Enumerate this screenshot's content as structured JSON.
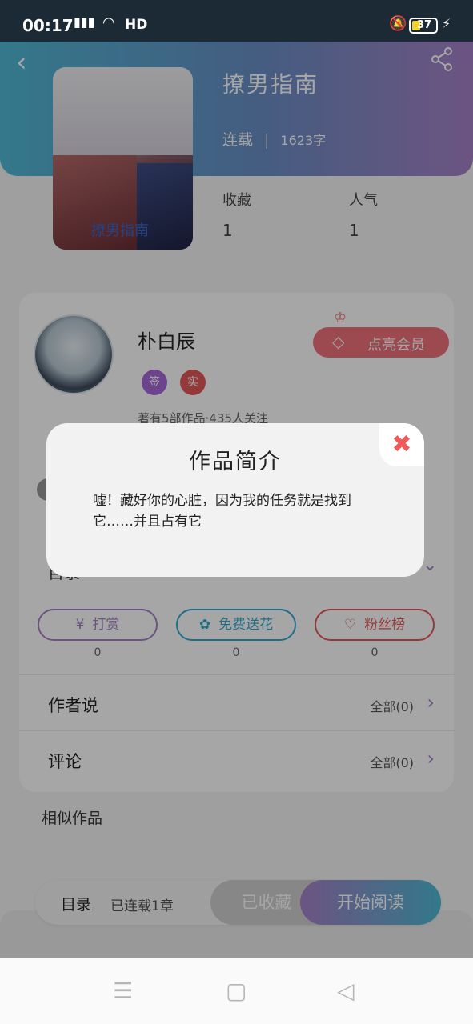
{
  "status_bar": {
    "time": "00:17",
    "network": "4G",
    "hd": "HD",
    "battery": "37"
  },
  "header": {
    "title": "撩男指南",
    "status": "连载",
    "word_count": "1623字"
  },
  "stats": [
    {
      "label": "收藏",
      "value": "1"
    },
    {
      "label": "人气",
      "value": "1"
    }
  ],
  "cover": {
    "text": "撩男指南"
  },
  "author": {
    "name": "朴白辰",
    "badge_sign": "签",
    "badge_real": "实",
    "works_info": "著有5部作品·435人关注",
    "vip_label": "点亮会员"
  },
  "directory": {
    "label": "目录"
  },
  "actions": [
    {
      "label": "打赏",
      "count": "0"
    },
    {
      "label": "免费送花",
      "count": "0"
    },
    {
      "label": "粉丝榜",
      "count": "0"
    }
  ],
  "author_says": {
    "label": "作者说",
    "all": "全部(0)"
  },
  "comments": {
    "label": "评论",
    "all": "全部(0)"
  },
  "similar": "相似作品",
  "bottom": {
    "dir_label": "目录",
    "progress": "已连载1章",
    "collected": "已收藏",
    "read": "开始阅读"
  },
  "modal": {
    "title": "作品简介",
    "body": "嘘！藏好你的心脏，因为我的任务就是找到它……并且占有它",
    "close": "✖"
  },
  "colors": {
    "accent_purple": "#a782c8",
    "accent_blue": "#4fb9d6",
    "red": "#e45858"
  }
}
